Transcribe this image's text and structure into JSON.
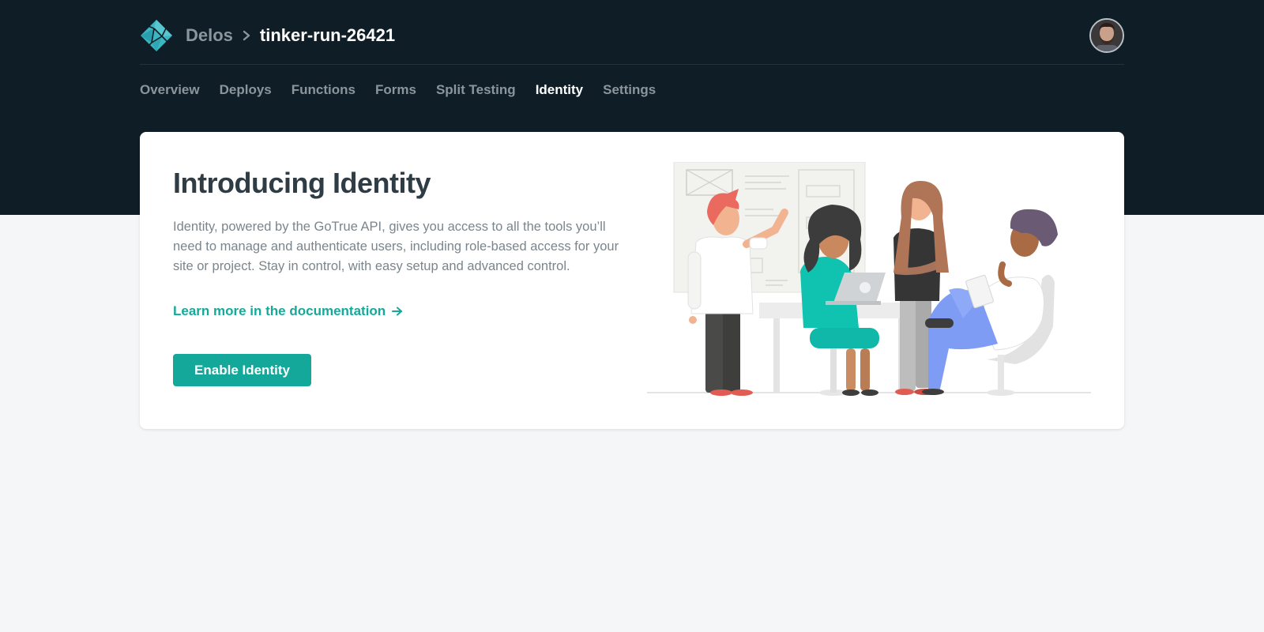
{
  "header": {
    "team_name": "Delos",
    "site_name": "tinker-run-26421",
    "logo_icon": "netlify-logo-icon",
    "avatar_icon": "user-avatar"
  },
  "tabs": [
    {
      "label": "Overview",
      "active": false
    },
    {
      "label": "Deploys",
      "active": false
    },
    {
      "label": "Functions",
      "active": false
    },
    {
      "label": "Forms",
      "active": false
    },
    {
      "label": "Split Testing",
      "active": false
    },
    {
      "label": "Identity",
      "active": true
    },
    {
      "label": "Settings",
      "active": false
    }
  ],
  "intro": {
    "title": "Introducing Identity",
    "description": "Identity, powered by the GoTrue API, gives you access to all the tools you’ll need to manage and authenticate users, including role-based access for your site or project. Stay in control, with easy setup and advanced control.",
    "doc_link": "Learn more in the documentation",
    "enable_button": "Enable Identity"
  },
  "colors": {
    "header_bg": "#0f1e26",
    "accent": "#14a89b",
    "page_bg": "#f5f6f8"
  }
}
